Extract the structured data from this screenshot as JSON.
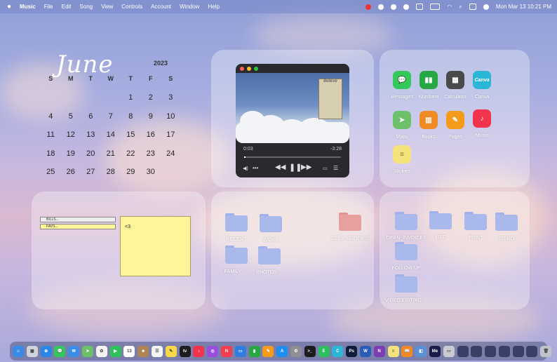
{
  "menubar": {
    "app_name": "Music",
    "menus": [
      "File",
      "Edit",
      "Song",
      "View",
      "Controls",
      "Account",
      "Window",
      "Help"
    ],
    "clock": "Mon Mar 13  10:21 PM"
  },
  "calendar": {
    "month": "June",
    "year": "2023",
    "weekdays": [
      "S",
      "M",
      "T",
      "W",
      "T",
      "F",
      "S"
    ],
    "weeks": [
      [
        "",
        "",
        "",
        "",
        "1",
        "2",
        "3"
      ],
      [
        "4",
        "5",
        "6",
        "7",
        "8",
        "9",
        "10"
      ],
      [
        "11",
        "12",
        "13",
        "14",
        "15",
        "16",
        "17"
      ],
      [
        "18",
        "19",
        "20",
        "21",
        "22",
        "23",
        "24"
      ],
      [
        "25",
        "26",
        "27",
        "28",
        "29",
        "30",
        ""
      ]
    ]
  },
  "player": {
    "album_text": "Believe",
    "elapsed": "0:03",
    "remaining": "-3:28",
    "progress": 0.015
  },
  "apps": [
    {
      "label": "Messages",
      "color": "#34c759",
      "glyph": "💬"
    },
    {
      "label": "Numbers",
      "color": "#27a844",
      "glyph": "📊"
    },
    {
      "label": "Calculator",
      "color": "#4a4a4a",
      "glyph": "▦"
    },
    {
      "label": "Canva",
      "color": "#2bb5d6",
      "glyph": "Canva"
    },
    {
      "label": "Maps",
      "color": "#6dc06a",
      "glyph": "➤"
    },
    {
      "label": "Books",
      "color": "#f08a24",
      "glyph": "📖"
    },
    {
      "label": "Pages",
      "color": "#f59b1b",
      "glyph": "✎"
    },
    {
      "label": "Music",
      "color": "#f2334d",
      "glyph": "♪"
    },
    {
      "label": "Stickies",
      "color": "#f4e27a",
      "glyph": "≡"
    }
  ],
  "stickies": {
    "tabs": [
      "BILLS...",
      "FAVS..."
    ],
    "note_text": "<3"
  },
  "folders_center": [
    {
      "label": "RECENT",
      "color": "#a9b9ec"
    },
    {
      "label": "WORK",
      "color": "#a9b9ec"
    },
    {
      "label": "ETSY_SHOP#02",
      "color": "#e8a09e"
    },
    {
      "label": "FAMILY",
      "color": "#a9b9ec"
    },
    {
      "label": "PHOTOS",
      "color": "#a9b9ec"
    }
  ],
  "folders_right": [
    {
      "label": "OPEN_INVOICES",
      "color": "#a9b9ec"
    },
    {
      "label": "LIFE",
      "color": "#a9b9ec"
    },
    {
      "label": "PRINT",
      "color": "#a9b9ec"
    },
    {
      "label": "TO DO",
      "color": "#a9b9ec"
    },
    {
      "label": "FOLLOW UP",
      "color": "#a9b9ec"
    },
    {
      "label": "VIDEO EDITING",
      "color": "#a9b9ec"
    }
  ],
  "dock": [
    {
      "name": "finder",
      "color": "#3a8be8",
      "glyph": "☺"
    },
    {
      "name": "launchpad",
      "color": "#cfd3dc",
      "glyph": "▦"
    },
    {
      "name": "safari",
      "color": "#2b86e6",
      "glyph": "⊕"
    },
    {
      "name": "messages",
      "color": "#34c759",
      "glyph": "💬"
    },
    {
      "name": "mail",
      "color": "#3b8ee8",
      "glyph": "✉"
    },
    {
      "name": "maps",
      "color": "#6dc06a",
      "glyph": "➤"
    },
    {
      "name": "photos",
      "color": "#f4f4f4",
      "glyph": "✿"
    },
    {
      "name": "facetime",
      "color": "#30c25a",
      "glyph": "▶"
    },
    {
      "name": "calendar",
      "color": "#ffffff",
      "glyph": "13"
    },
    {
      "name": "contacts",
      "color": "#b08555",
      "glyph": "☻"
    },
    {
      "name": "reminders",
      "color": "#f6f6f6",
      "glyph": "☰"
    },
    {
      "name": "notes",
      "color": "#f8d94a",
      "glyph": "✎"
    },
    {
      "name": "tv",
      "color": "#1c1c1e",
      "glyph": "tv"
    },
    {
      "name": "music",
      "color": "#f2334d",
      "glyph": "♪"
    },
    {
      "name": "podcasts",
      "color": "#9b4de0",
      "glyph": "◎"
    },
    {
      "name": "news",
      "color": "#f23e4f",
      "glyph": "N"
    },
    {
      "name": "keynote",
      "color": "#2f7de0",
      "glyph": "▭"
    },
    {
      "name": "numbers",
      "color": "#27a844",
      "glyph": "▮"
    },
    {
      "name": "pages",
      "color": "#f59b1b",
      "glyph": "✎"
    },
    {
      "name": "app-store",
      "color": "#1e8ef0",
      "glyph": "A"
    },
    {
      "name": "system-settings",
      "color": "#8e8e93",
      "glyph": "⚙"
    },
    {
      "name": "terminal",
      "color": "#1c1c1e",
      "glyph": ">_"
    },
    {
      "name": "evernote",
      "color": "#2dbe60",
      "glyph": "E"
    },
    {
      "name": "canva",
      "color": "#2bb5d6",
      "glyph": "C"
    },
    {
      "name": "photoshop",
      "color": "#0b1f3a",
      "glyph": "Ps"
    },
    {
      "name": "word",
      "color": "#2b5cb8",
      "glyph": "W"
    },
    {
      "name": "onenote",
      "color": "#7b3db1",
      "glyph": "N"
    },
    {
      "name": "stickies",
      "color": "#f4e27a",
      "glyph": "≡"
    },
    {
      "name": "books",
      "color": "#f08a24",
      "glyph": "📖"
    },
    {
      "name": "preview",
      "color": "#5b8fd6",
      "glyph": "◧"
    },
    {
      "name": "media-encoder",
      "color": "#1a1b4a",
      "glyph": "Me"
    },
    {
      "name": "screenshot",
      "color": "#c9cbd1",
      "glyph": "▭"
    },
    {
      "name": "window-1",
      "color": "#3a3f66",
      "glyph": ""
    },
    {
      "name": "window-2",
      "color": "#3a3f66",
      "glyph": ""
    },
    {
      "name": "window-3",
      "color": "#3a3f66",
      "glyph": ""
    },
    {
      "name": "window-4",
      "color": "#3a3f66",
      "glyph": ""
    },
    {
      "name": "window-5",
      "color": "#3a3f66",
      "glyph": ""
    },
    {
      "name": "window-6",
      "color": "#3a3f66",
      "glyph": ""
    },
    {
      "name": "trash",
      "color": "#c0c3ca",
      "glyph": "🗑"
    }
  ]
}
